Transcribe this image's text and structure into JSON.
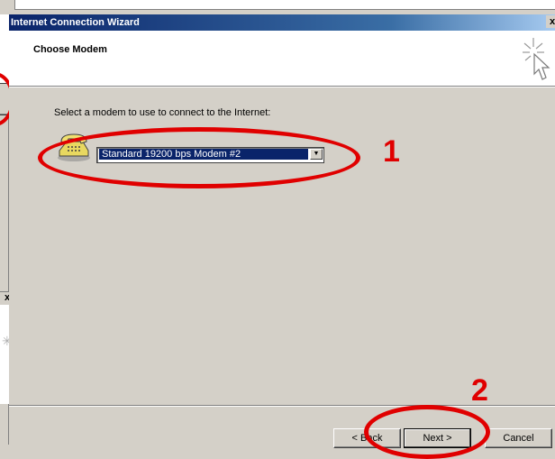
{
  "window": {
    "title": "Internet Connection Wizard",
    "close_label": "x",
    "background_close_label": "x"
  },
  "header": {
    "title": "Choose Modem",
    "icon": "wizard-cursor-icon"
  },
  "content": {
    "instruction": "Select a modem to use to connect to the Internet:",
    "modem_select": {
      "selected": "Standard 19200 bps Modem #2",
      "icon": "telephone-icon"
    }
  },
  "annotations": {
    "label_1": "1",
    "label_2": "2",
    "color": "#e00000"
  },
  "buttons": {
    "back": "< Back",
    "next": "Next >",
    "cancel": "Cancel"
  },
  "colors": {
    "titlebar_start": "#0a246a",
    "titlebar_end": "#a6caf0",
    "face": "#d4d0c8",
    "selection": "#0a246a"
  }
}
